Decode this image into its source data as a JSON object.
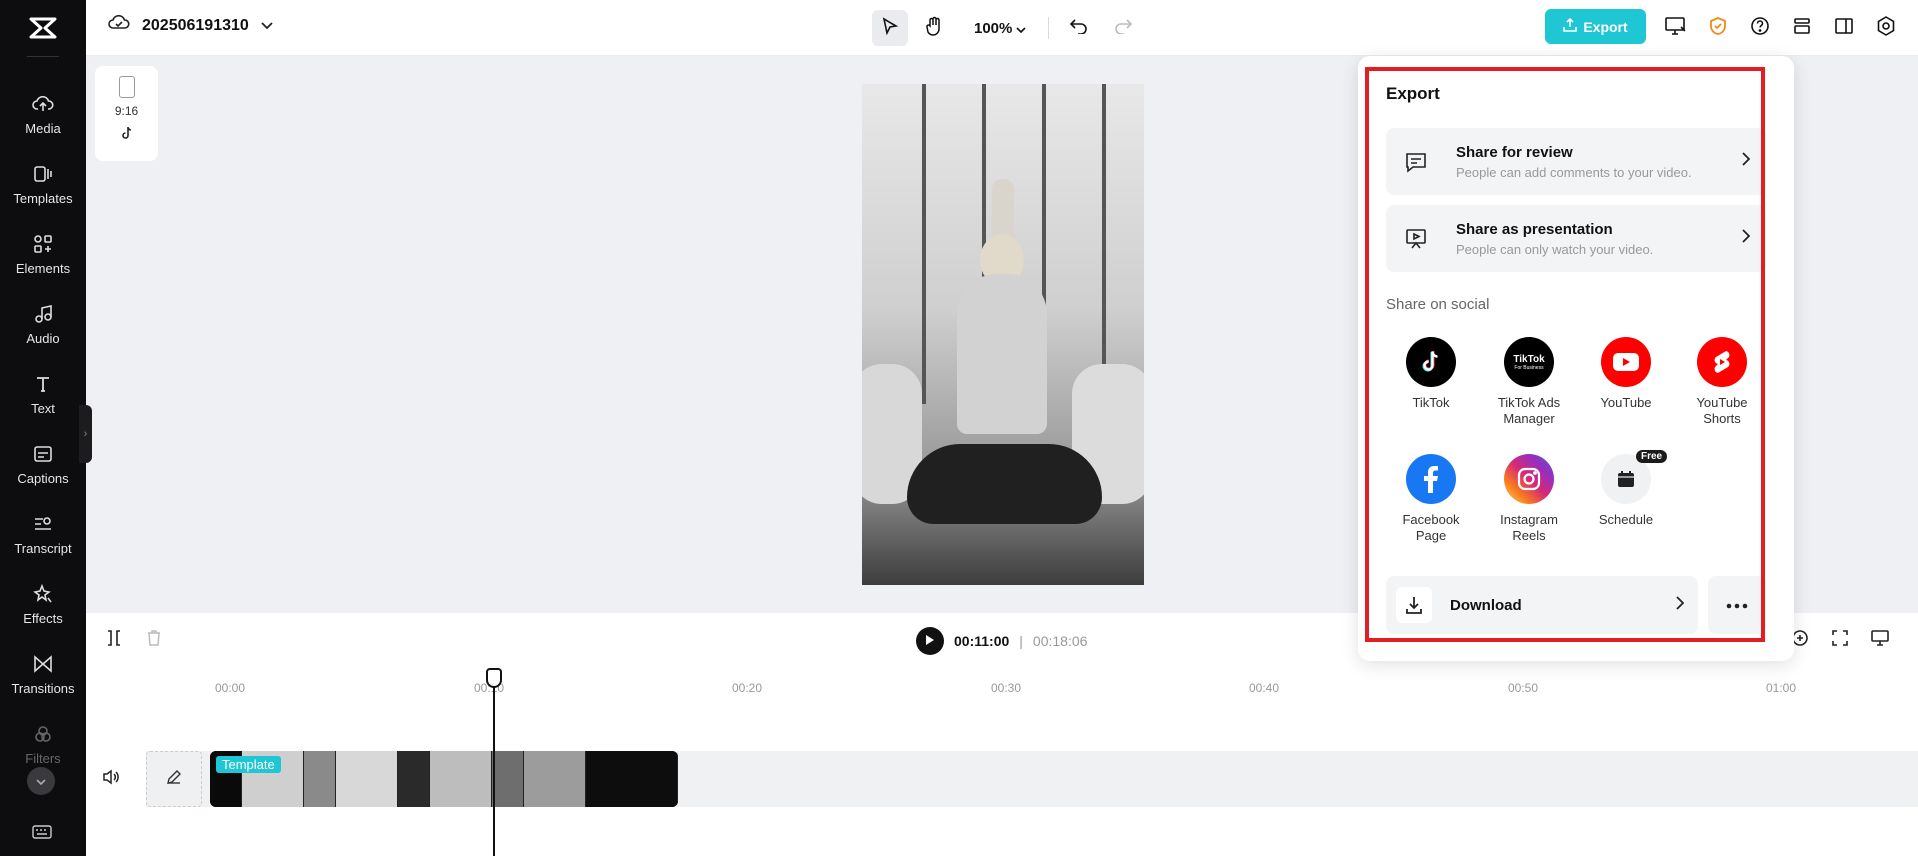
{
  "sidebar": {
    "items": [
      {
        "label": "Media",
        "icon": "cloud-upload-icon"
      },
      {
        "label": "Templates",
        "icon": "templates-icon"
      },
      {
        "label": "Elements",
        "icon": "elements-icon"
      },
      {
        "label": "Audio",
        "icon": "music-note-icon"
      },
      {
        "label": "Text",
        "icon": "text-icon"
      },
      {
        "label": "Captions",
        "icon": "captions-icon"
      },
      {
        "label": "Transcript",
        "icon": "transcript-icon"
      },
      {
        "label": "Effects",
        "icon": "effects-icon"
      },
      {
        "label": "Transitions",
        "icon": "transitions-icon"
      },
      {
        "label": "Filters",
        "icon": "filters-icon"
      }
    ]
  },
  "header": {
    "project_title": "202506191310",
    "zoom": "100%",
    "export_label": "Export"
  },
  "canvas": {
    "ratio_label": "9:16"
  },
  "playback": {
    "current_time": "00:11:00",
    "separator": "|",
    "total_time": "00:18:06"
  },
  "ruler": {
    "labels": [
      "00:00",
      "00:10",
      "00:20",
      "00:30",
      "00:40",
      "00:50",
      "01:00"
    ]
  },
  "track": {
    "clip_tag": "Template"
  },
  "export_panel": {
    "title": "Export",
    "share_review": {
      "title": "Share for review",
      "subtitle": "People can add comments to your video."
    },
    "share_presentation": {
      "title": "Share as presentation",
      "subtitle": "People can only watch your video."
    },
    "social_heading": "Share on social",
    "socials": [
      {
        "label": "TikTok",
        "color": "#000000"
      },
      {
        "label": "TikTok Ads Manager",
        "color": "#000000"
      },
      {
        "label": "YouTube",
        "color": "#ff0000"
      },
      {
        "label": "YouTube Shorts",
        "color": "#ff0000"
      },
      {
        "label": "Facebook Page",
        "color": "#1877f2"
      },
      {
        "label": "Instagram Reels",
        "color": "#d62976"
      },
      {
        "label": "Schedule",
        "color": "#f0f1f3"
      }
    ],
    "tiktok_business_logo": {
      "name": "TikTok",
      "sub": "For Business"
    },
    "free_badge": "Free",
    "download_label": "Download"
  },
  "colors": {
    "accent": "#1fc6d4",
    "highlight": "#e41d25"
  }
}
